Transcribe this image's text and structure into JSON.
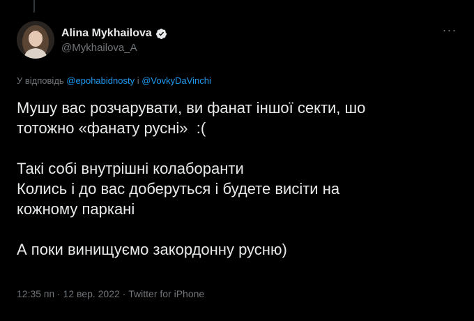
{
  "tweet": {
    "author": {
      "display_name": "Alina Mykhailova",
      "handle": "@Mykhailova_A",
      "verified": true
    },
    "more_icon": "more-horizontal-icon",
    "reply_context": {
      "prefix": "У відповідь",
      "mention_1": "@epohabidnosty",
      "joiner": "і",
      "mention_2": "@VovkyDaVinchi"
    },
    "body_lines": [
      "Мушу вас розчарувати, ви фанат іншої секти, шо",
      "тотожно «фанату русні»  :(",
      "",
      "Такі собі внутрішні колаборанти",
      "Колись і до вас доберуться і будете висіти на",
      "кожному паркані",
      "",
      "А поки винищуємо закордонну русню)"
    ],
    "meta": {
      "time": "12:35 пп",
      "separator": "·",
      "date": "12 вер. 2022",
      "source": "Twitter for iPhone"
    }
  },
  "colors": {
    "background": "#000000",
    "text_primary": "#e7e9ea",
    "text_secondary": "#71767b",
    "link": "#1d9bf0",
    "verified": "#1d9bf0"
  }
}
